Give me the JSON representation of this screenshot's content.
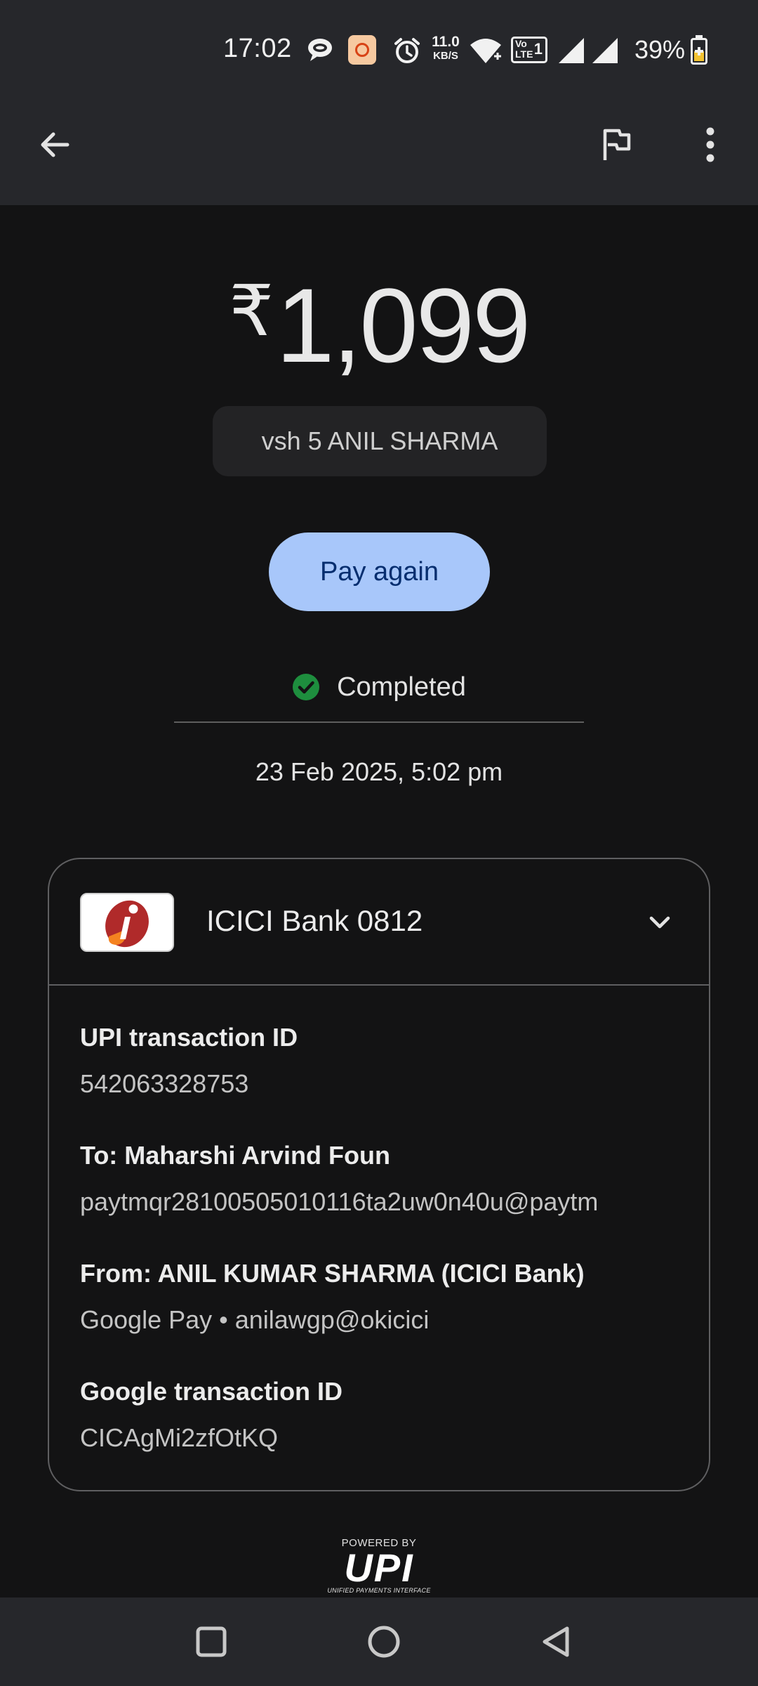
{
  "status_bar": {
    "time": "17:02",
    "net_speed_top": "11.0",
    "net_speed_unit": "KB/S",
    "volte_top": "Vo",
    "volte_bottom": "LTE",
    "sim_slot": "1",
    "battery_percent": "39%",
    "icons": [
      "chat-bubble-icon",
      "bsnl-app-icon",
      "alarm-icon",
      "wifi-icon",
      "volte-icon",
      "signal-icon",
      "signal-icon",
      "battery-charging-icon"
    ]
  },
  "app_bar": {
    "back_icon": "arrow-back-icon",
    "report_icon": "flag-icon",
    "menu_icon": "more-vert-icon"
  },
  "transaction": {
    "currency_symbol": "₹",
    "amount": "1,099",
    "note": "vsh 5 ANIL SHARMA",
    "pay_again_label": "Pay again",
    "status": "Completed",
    "datetime": "23 Feb 2025, 5:02 pm"
  },
  "card": {
    "bank_label": "ICICI Bank 0812",
    "details": [
      {
        "label": "UPI transaction ID",
        "value": "542063328753"
      },
      {
        "label": "To: Maharshi Arvind Foun",
        "value": "paytmqr28100505010116ta2uw0n40u@paytm"
      },
      {
        "label": "From: ANIL KUMAR SHARMA (ICICI Bank)",
        "value": "Google Pay • anilawgp@okicici"
      },
      {
        "label": "Google transaction ID",
        "value": "CICAgMi2zfOtKQ"
      }
    ]
  },
  "footer": {
    "powered_by": "POWERED BY",
    "upi_mark": "UPI",
    "upi_sub": "UNIFIED PAYMENTS INTERFACE"
  },
  "colors": {
    "background": "#131314",
    "topbar": "#26272b",
    "button": "#a8c7fa",
    "button_text": "#062e6f",
    "success": "#1e8e3e"
  }
}
